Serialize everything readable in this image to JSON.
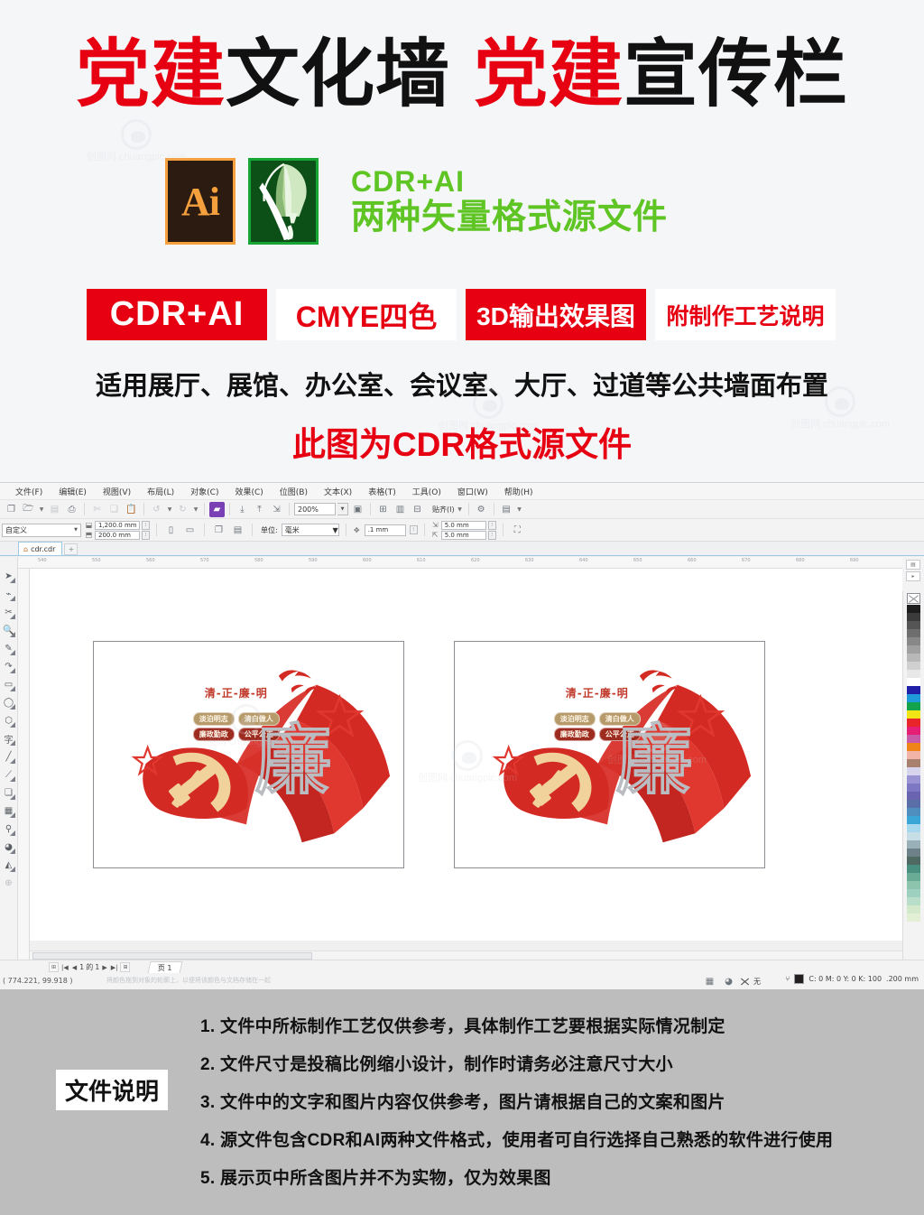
{
  "promo": {
    "title_parts": [
      {
        "text": "党建",
        "color": "red"
      },
      {
        "text": "文化墙",
        "color": "black"
      },
      {
        "text": "党建",
        "color": "red"
      },
      {
        "text": "宣传栏",
        "color": "black"
      }
    ],
    "software": {
      "ai_label": "Ai",
      "cdr_icon_name": "coreldraw-balloon-icon",
      "line1": "CDR+AI",
      "line2": "两种矢量格式源文件"
    },
    "badges": [
      {
        "label": "CDR+AI",
        "style": "solid"
      },
      {
        "label": "CMYE四色",
        "style": "ghost"
      },
      {
        "label": "3D输出效果图",
        "style": "solid"
      },
      {
        "label": "附制作工艺说明",
        "style": "ghost"
      }
    ],
    "usage_text": "适用展厅、展馆、办公室、会议室、大厅、过道等公共墙面布置",
    "format_note": "此图为CDR格式源文件",
    "watermark": "创图网 chuangpic.com",
    "colors": {
      "red": "#e60012",
      "green": "#5fc524",
      "black": "#111111"
    }
  },
  "app": {
    "menu": [
      "文件(F)",
      "编辑(E)",
      "视图(V)",
      "布局(L)",
      "对象(C)",
      "效果(C)",
      "位图(B)",
      "文本(X)",
      "表格(T)",
      "工具(O)",
      "窗口(W)",
      "帮助(H)"
    ],
    "toolbar": {
      "zoom_level": "200%",
      "snap_label": "贴齐(I)",
      "icons": [
        "new-document-icon",
        "open-folder-icon",
        "save-icon",
        "print-icon",
        "cut-icon",
        "copy-icon",
        "paste-icon",
        "undo-icon",
        "redo-icon",
        "publish-pdf-icon",
        "import-icon",
        "export-icon",
        "zoom-icon",
        "fullscreen-icon",
        "align-icon",
        "options-icon",
        "app-launcher-icon"
      ]
    },
    "property_bar": {
      "page_preset": "自定义",
      "width": "1,200.0 mm",
      "height": "200.0 mm",
      "unit_label": "单位:",
      "unit_value": "毫米",
      "nudge": ".1 mm",
      "duplicate_x": "5.0 mm",
      "duplicate_y": "5.0 mm"
    },
    "document_tab": "cdr.cdr",
    "toolbox": [
      "pick-tool-icon",
      "shape-tool-icon",
      "crop-tool-icon",
      "zoom-tool-icon",
      "freehand-tool-icon",
      "artistic-media-icon",
      "rectangle-tool-icon",
      "ellipse-tool-icon",
      "polygon-tool-icon",
      "text-tool-icon",
      "dimension-tool-icon",
      "connector-tool-icon",
      "drop-shadow-icon",
      "transparency-tool-icon",
      "color-eyedropper-icon",
      "interactive-fill-icon",
      "smart-fill-icon",
      "add-tool-icon"
    ],
    "ruler_ticks": [
      "540",
      "550",
      "560",
      "570",
      "580",
      "590",
      "600",
      "610",
      "620",
      "630",
      "640",
      "650",
      "660",
      "670",
      "680",
      "690"
    ],
    "status": {
      "coordinates": "( 774.221, 99.918 )",
      "hint": "将颜色拖到对象的轮廓上，以便将该颜色与文档存储在一起",
      "fill_none_label": "无",
      "outline_color": "C: 0 M: 0 Y: 0 K: 100",
      "outline_width": ".200 mm"
    },
    "page_nav": {
      "current": "1",
      "of_label": "的",
      "total": "1",
      "page_tab": "页 1"
    }
  },
  "artwork": {
    "title": "清-正-廉-明",
    "pills": [
      {
        "label": "淡泊明志",
        "tone": "tan"
      },
      {
        "label": "清白做人",
        "tone": "tan"
      },
      {
        "label": "廉政勤政",
        "tone": "red"
      },
      {
        "label": "公平公正",
        "tone": "red"
      }
    ],
    "big_character": "廉",
    "emblem_name": "party-hammer-sickle-emblem",
    "colors": {
      "ribbon_red": "#d42a24",
      "ribbon_dark": "#b01f1a",
      "emblem_gold": "#f0d29a",
      "title_red": "#c0392b",
      "pill_tan": "#b79a6a",
      "pill_red": "#9e2b20"
    }
  },
  "footer": {
    "label": "文件说明",
    "notes": [
      "1. 文件中所标制作工艺仅供参考，具体制作工艺要根据实际情况制定",
      "2. 文件尺寸是投稿比例缩小设计，制作时请务必注意尺寸大小",
      "3. 文件中的文字和图片内容仅供参考，图片请根据自己的文案和图片",
      "4. 源文件包含CDR和AI两种文件格式，使用者可自行选择自己熟悉的软件进行使用",
      "5. 展示页中所含图片并不为实物，仅为效果图"
    ]
  }
}
